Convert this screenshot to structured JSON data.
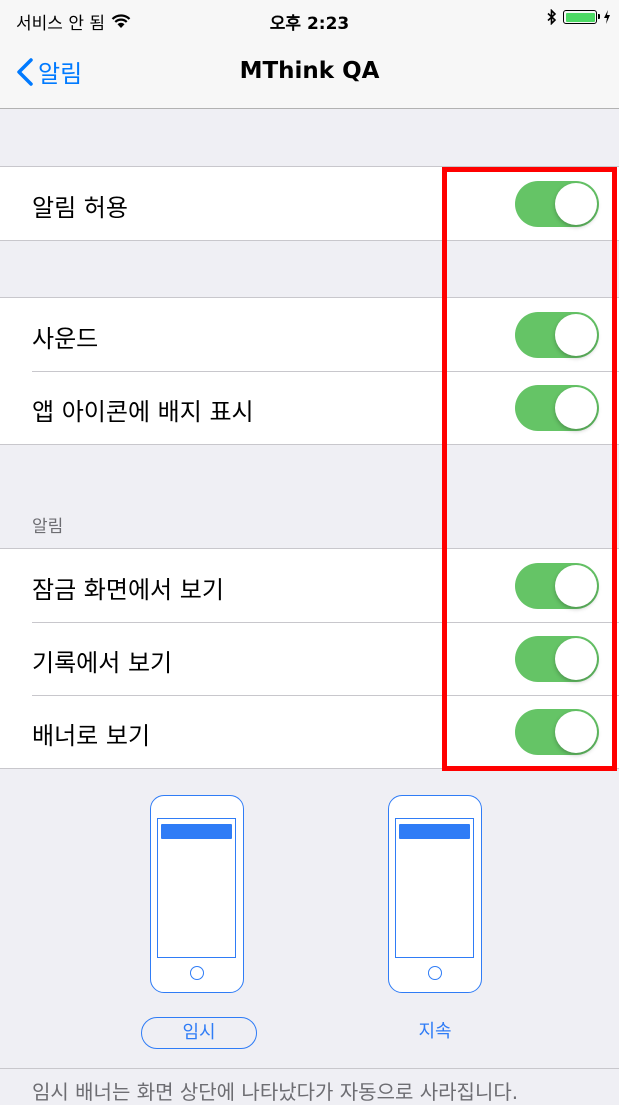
{
  "status_bar": {
    "carrier": "서비스 안 됨",
    "time": "오후 2:23",
    "battery_level": 1.0
  },
  "nav": {
    "back_label": "알림",
    "title": "MThink QA"
  },
  "groups": {
    "allow": [
      {
        "label": "알림 허용",
        "on": true
      }
    ],
    "sound_badge": [
      {
        "label": "사운드",
        "on": true
      },
      {
        "label": "앱 아이콘에 배지 표시",
        "on": true
      }
    ],
    "alerts_header": "알림",
    "alerts": [
      {
        "label": "잠금 화면에서 보기",
        "on": true
      },
      {
        "label": "기록에서 보기",
        "on": true
      },
      {
        "label": "배너로 보기",
        "on": true
      }
    ]
  },
  "banner_style": {
    "options": [
      {
        "label": "임시",
        "selected": true
      },
      {
        "label": "지속",
        "selected": false
      }
    ],
    "footer": "임시 배너는 화면 상단에 나타났다가 자동으로 사라집니다."
  },
  "colors": {
    "toggle_on": "#65c466",
    "accent": "#007aff",
    "highlight": "#ff0000"
  }
}
